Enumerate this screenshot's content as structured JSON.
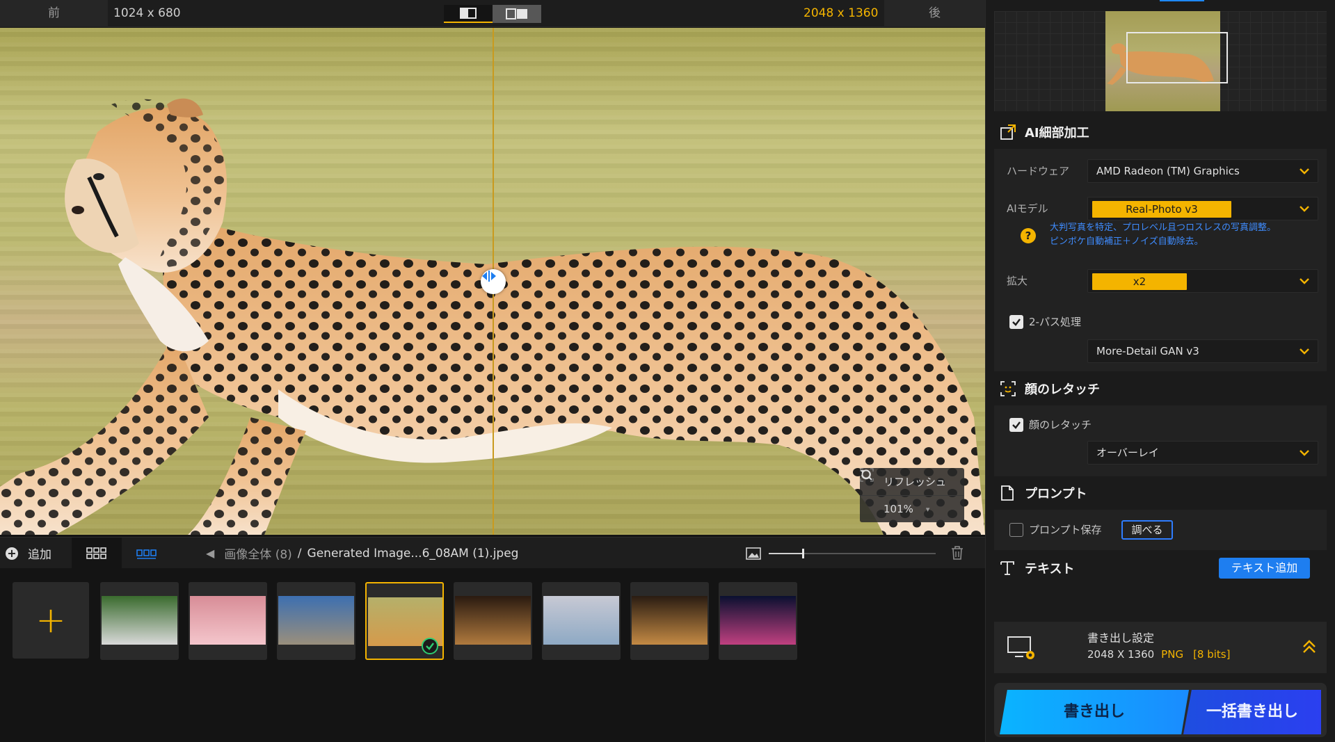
{
  "topbar": {
    "before_label": "前",
    "before_res": "1024 x 680",
    "after_res": "2048 x 1360",
    "after_label": "後"
  },
  "overlay": {
    "refresh_label": "リフレッシュ",
    "zoom_value": "101%"
  },
  "toolbar": {
    "add_label": "追加",
    "crumb_all": "画像全体 (8)",
    "crumb_sep": "/",
    "crumb_current": "Generated Image...6_08AM (1).jpeg",
    "zoom_slider_fraction": 0.2
  },
  "thumbnails": [
    {
      "name": "soccer",
      "colors": [
        "#3a6b2e",
        "#d9d9d9"
      ]
    },
    {
      "name": "rose",
      "colors": [
        "#d88d97",
        "#f4c6cc"
      ]
    },
    {
      "name": "mountains",
      "colors": [
        "#3d6fb0",
        "#9a8f7c"
      ]
    },
    {
      "name": "cheetah",
      "colors": [
        "#b5b06a",
        "#d59a4b"
      ],
      "selected": true
    },
    {
      "name": "restaurant",
      "colors": [
        "#2a1a10",
        "#b07a3e"
      ]
    },
    {
      "name": "beach",
      "colors": [
        "#c7c9d4",
        "#8ea9c4"
      ]
    },
    {
      "name": "dining-room",
      "colors": [
        "#2a1c12",
        "#c48a44"
      ]
    },
    {
      "name": "city-night",
      "colors": [
        "#0a1030",
        "#c04080"
      ]
    }
  ],
  "panel": {
    "ai_section_title": "AI細部加工",
    "hardware_label": "ハードウェア",
    "hardware_value": "AMD Radeon (TM) Graphics",
    "model_label": "AIモデル",
    "model_value": "Real-Photo  v3",
    "model_hint_1": "大判写真を特定、プロレベル且つロスレスの写真調整。",
    "model_hint_2": "ピンボケ自動補正＋ノイズ自動除去。",
    "scale_label": "拡大",
    "scale_value": "x2",
    "twopass_label": "2-パス処理",
    "twopass_checked": true,
    "twopass_model": "More-Detail GAN  v3",
    "face_section_title": "顔のレタッチ",
    "face_label": "顔のレタッチ",
    "face_checked": true,
    "face_mode": "オーバーレイ",
    "prompt_section_title": "プロンプト",
    "prompt_save_label": "プロンプト保存",
    "prompt_save_checked": false,
    "prompt_lookup_button": "調べる",
    "text_section_title": "テキスト",
    "text_add_button": "テキスト追加",
    "export_title": "書き出し設定",
    "export_size": "2048 X 1360",
    "export_format": "PNG",
    "export_bits": "[8 bits]",
    "export_button": "書き出し",
    "batch_export_button": "一括書き出し"
  },
  "colors": {
    "accent_yellow": "#f4b400",
    "accent_blue": "#1e7ef0",
    "link_blue": "#3f8cff"
  }
}
